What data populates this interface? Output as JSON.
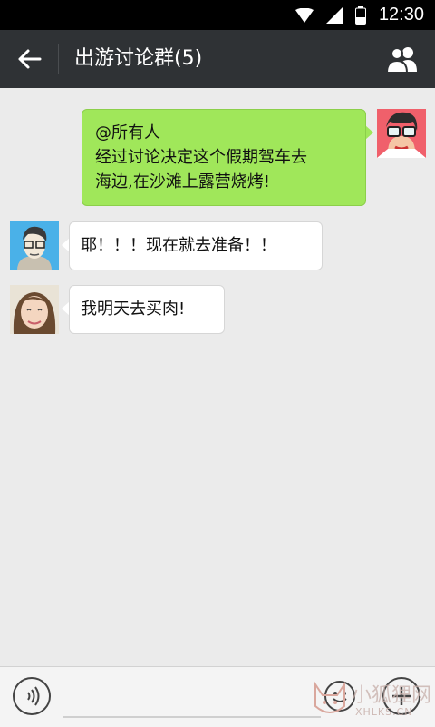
{
  "status_bar": {
    "time": "12:30",
    "icons": [
      "wifi-icon",
      "signal-icon",
      "battery-icon"
    ]
  },
  "header": {
    "title": "出游讨论群(5)",
    "back_icon": "arrow-left-icon",
    "members_icon": "group-members-icon"
  },
  "messages": [
    {
      "side": "right",
      "avatar": "avatar-glasses-cartoon",
      "lines": [
        "@所有人",
        "经过讨论决定这个假期驾车去",
        "海边,在沙滩上露营烧烤!"
      ]
    },
    {
      "side": "left",
      "avatar": "avatar-man-sketch",
      "lines": [
        "耶！！！现在就去准备！！"
      ]
    },
    {
      "side": "left",
      "avatar": "avatar-girl-photo",
      "lines": [
        "我明天去买肉!"
      ]
    }
  ],
  "input_bar": {
    "voice_icon": "voice-icon",
    "emoji_icon": "emoji-icon",
    "plus_icon": "plus-icon",
    "input_value": ""
  },
  "watermark": {
    "text": "小狐狸网",
    "subtext": "XHLKS.CN"
  },
  "colors": {
    "titlebar": "#2f3235",
    "my_bubble": "#a0e75a",
    "background": "#ebebeb"
  }
}
